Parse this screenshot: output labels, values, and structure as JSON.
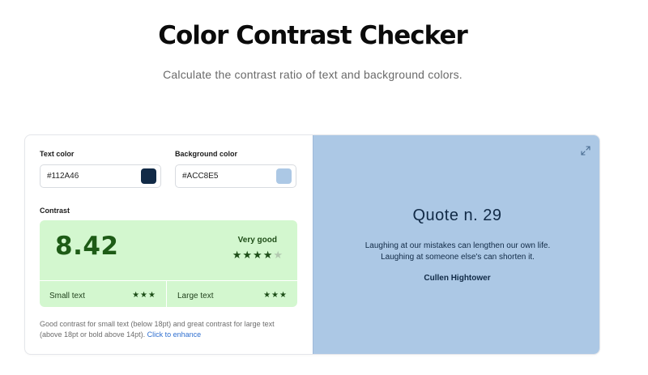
{
  "header": {
    "title": "Color Contrast Checker",
    "subtitle": "Calculate the contrast ratio of text and background colors."
  },
  "inputs": {
    "text_color_label": "Text color",
    "text_color_value": "#112A46",
    "background_color_label": "Background color",
    "background_color_value": "#ACC8E5"
  },
  "contrast": {
    "label": "Contrast",
    "ratio": "8.42",
    "rating": "Very good",
    "rating_stars": 4,
    "rating_stars_max": 5,
    "small_text_label": "Small text",
    "small_text_stars": "★★★",
    "large_text_label": "Large text",
    "large_text_stars": "★★★",
    "description": "Good contrast for small text (below 18pt) and great contrast for large text (above 18pt or bold above 14pt).",
    "enhance_link": "Click to enhance"
  },
  "preview": {
    "title": "Quote n. 29",
    "line1": "Laughing at our mistakes can lengthen our own life.",
    "line2": "Laughing at someone else's can shorten it.",
    "author": "Cullen Hightower",
    "expand_icon": "expand-icon"
  },
  "colors": {
    "text_color": "#112A46",
    "background_color": "#ACC8E5",
    "contrast_box": "#D3F7CF",
    "link": "#2F6FD0"
  }
}
